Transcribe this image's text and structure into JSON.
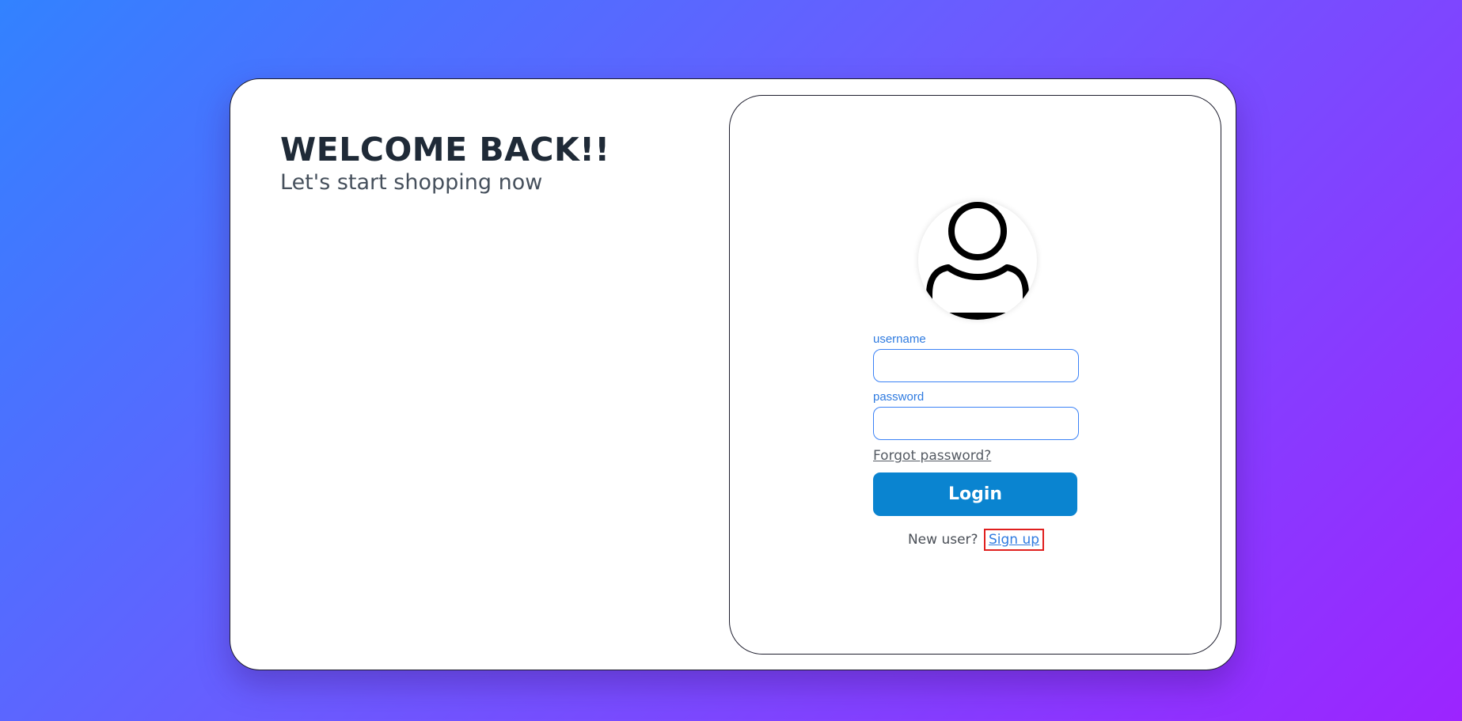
{
  "welcome": {
    "title": "WELCOME BACK!!",
    "subtitle": "Let's start shopping now"
  },
  "login_form": {
    "avatar_icon": "user-icon",
    "username_label": "username",
    "username_value": "",
    "password_label": "password",
    "password_value": "",
    "forgot_label": "Forgot password?",
    "login_label": "Login",
    "new_user_text": "New user?",
    "signup_label": "Sign up"
  },
  "colors": {
    "bg_gradient_start": "#3282ff",
    "bg_gradient_end": "#9c24ff",
    "accent": "#2f7be0",
    "login_button": "#0a84d0",
    "highlight_box": "#e0201f"
  }
}
